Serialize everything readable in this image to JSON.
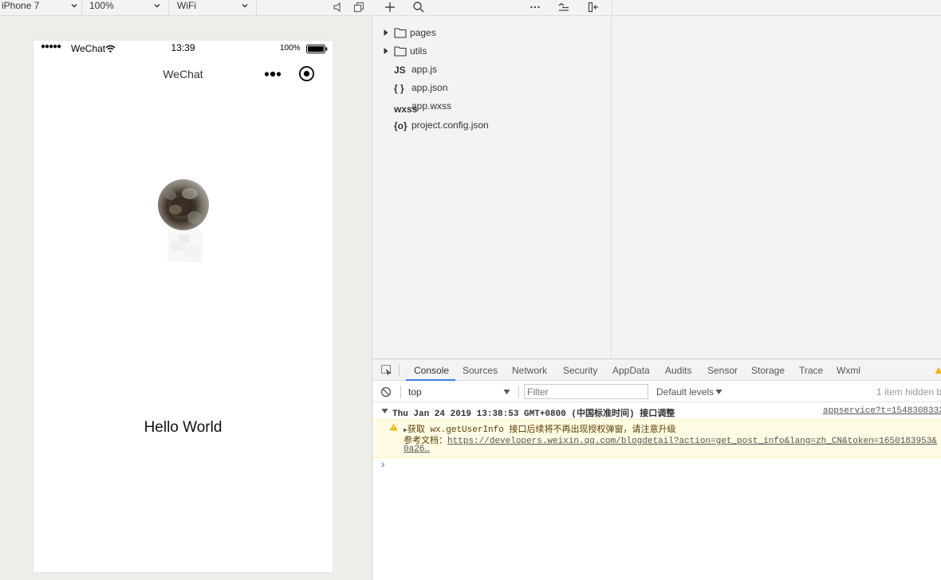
{
  "simulator": {
    "device": "iPhone 7",
    "zoom": "100%",
    "network": "WiFi",
    "statusbar": {
      "signal": "●●●●●",
      "carrier": "WeChat",
      "time": "13:39",
      "battery": "100%"
    },
    "nav_title": "WeChat",
    "hello_text": "Hello World"
  },
  "file_tree": {
    "items": [
      {
        "name": "pages",
        "type": "folder",
        "icon": "folder-icon"
      },
      {
        "name": "utils",
        "type": "folder",
        "icon": "folder-icon"
      },
      {
        "name": "app.js",
        "type": "file",
        "icon": "js-file-icon",
        "badge": "JS"
      },
      {
        "name": "app.json",
        "type": "file",
        "icon": "json-file-icon",
        "badge": "{ }"
      },
      {
        "name": "app.wxss",
        "type": "file",
        "icon": "wxss-file-icon",
        "badge": "wxss"
      },
      {
        "name": "project.config.json",
        "type": "file",
        "icon": "config-file-icon",
        "badge": "{o}"
      }
    ]
  },
  "devtools": {
    "tabs": [
      "Console",
      "Sources",
      "Network",
      "Security",
      "AppData",
      "Audits",
      "Sensor",
      "Storage",
      "Trace",
      "Wxml"
    ],
    "active_tab": "Console",
    "context": "top",
    "filter_placeholder": "Filter",
    "levels": "Default levels",
    "hidden_info": "1 item hidden b",
    "log": {
      "group_title": "Thu Jan 24 2019 13:38:53 GMT+0800 (中国标准时间) 接口调整",
      "group_source": "appservice?t=1548308332",
      "warn_prefix": "获取 ",
      "warn_api": "wx.getUserInfo",
      "warn_suffix": " 接口后续将不再出现授权弹窗，请注意升级",
      "doc_label": "参考文档：",
      "doc_link": "https://developers.weixin.qq.com/blogdetail?action=get_post_info&lang=zh_CN&token=1650183953&",
      "doc_link_cont": "0a26…",
      "prompt": "›"
    }
  },
  "colors": {
    "accent_tab": "#3f7be6",
    "warn_bg": "#fffbe5",
    "warn_icon": "#f0b400",
    "prompt": "#3f7be6"
  }
}
